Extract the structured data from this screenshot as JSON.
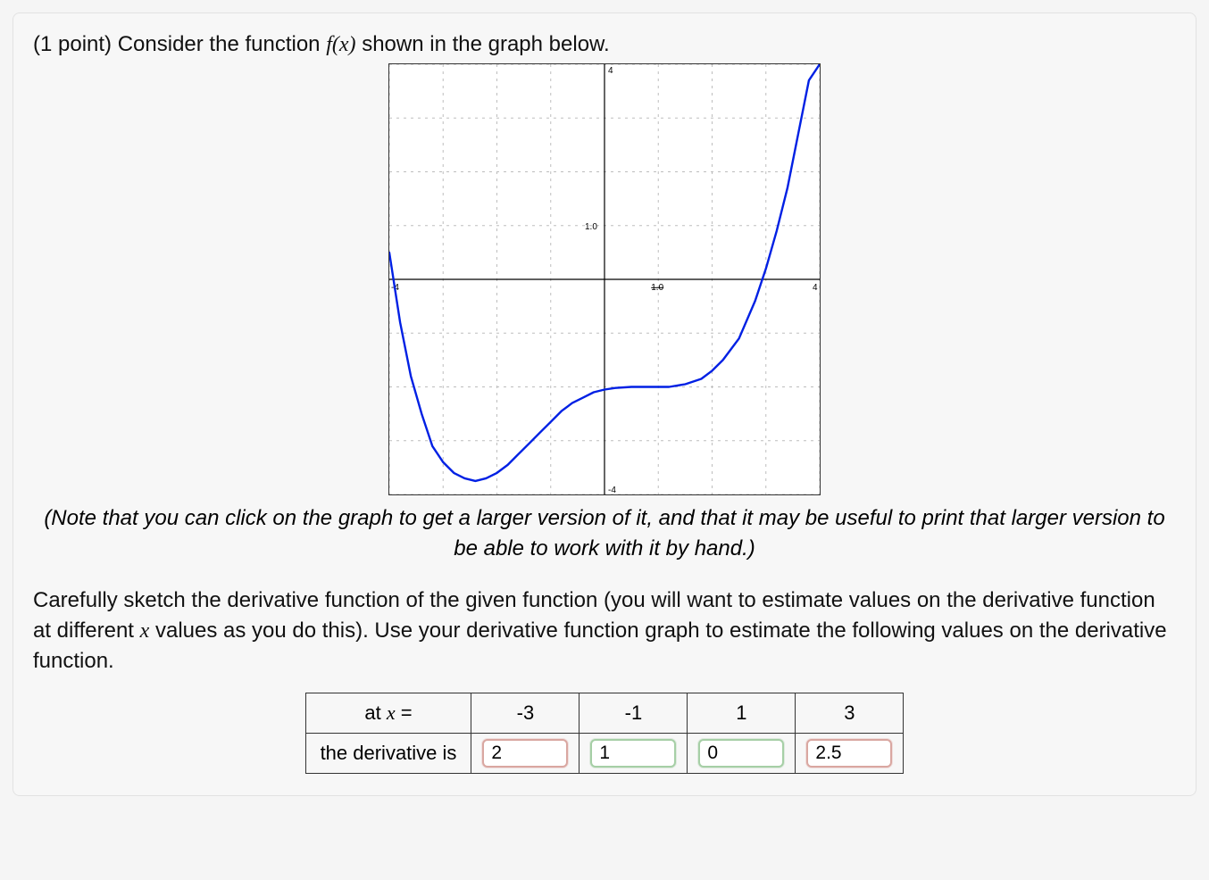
{
  "question": {
    "points_prefix": "(1 point) ",
    "intro1": "Consider the function ",
    "fn": "f(x)",
    "intro2": " shown in the graph below."
  },
  "note": "(Note that you can click on the graph to get a larger version of it, and that it may be useful to print that larger version to be able to work with it by hand.)",
  "body": {
    "p1a": "Carefully sketch the derivative function of the given function (you will want to estimate values on the derivative function at different ",
    "var": "x",
    "p1b": " values as you do this). Use your derivative function graph to estimate the following values on the derivative function."
  },
  "table": {
    "row1_label_a": "at ",
    "row1_label_var": "x",
    "row1_label_b": " =",
    "columns": [
      "-3",
      "-1",
      "1",
      "3"
    ],
    "row2_label": "the derivative is",
    "answers": [
      "2",
      "1",
      "0",
      "2.5"
    ],
    "status": [
      "wrong",
      "right",
      "right",
      "wrong"
    ]
  },
  "chart_data": {
    "type": "line",
    "title": "",
    "xlabel": "",
    "ylabel": "",
    "xlim": [
      -4,
      4
    ],
    "ylim": [
      -4,
      4
    ],
    "x_tick_labels": [
      "-4",
      "1.0",
      "4"
    ],
    "y_tick_labels": [
      "-4",
      "1.0",
      "4"
    ],
    "series": [
      {
        "name": "f(x)",
        "x": [
          -4,
          -3.8,
          -3.6,
          -3.4,
          -3.2,
          -3.0,
          -2.8,
          -2.6,
          -2.4,
          -2.2,
          -2.0,
          -1.8,
          -1.6,
          -1.4,
          -1.2,
          -1.0,
          -0.8,
          -0.6,
          -0.4,
          -0.2,
          0.0,
          0.2,
          0.5,
          0.8,
          1.0,
          1.2,
          1.5,
          1.8,
          2.0,
          2.2,
          2.5,
          2.8,
          3.0,
          3.2,
          3.4,
          3.6,
          3.8,
          4.0
        ],
        "y": [
          0.5,
          -0.8,
          -1.8,
          -2.5,
          -3.1,
          -3.4,
          -3.6,
          -3.7,
          -3.75,
          -3.7,
          -3.6,
          -3.45,
          -3.25,
          -3.05,
          -2.85,
          -2.65,
          -2.45,
          -2.3,
          -2.2,
          -2.1,
          -2.05,
          -2.02,
          -2.0,
          -2.0,
          -2.0,
          -2.0,
          -1.95,
          -1.85,
          -1.7,
          -1.5,
          -1.1,
          -0.4,
          0.2,
          0.9,
          1.7,
          2.7,
          3.7,
          4.0
        ]
      }
    ]
  }
}
